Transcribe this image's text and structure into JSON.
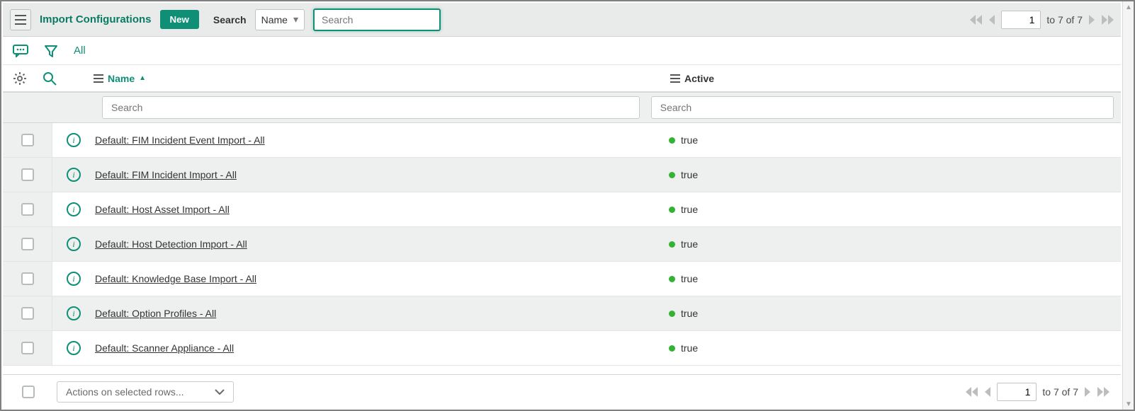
{
  "toolbar": {
    "title": "Import Configurations",
    "new_label": "New",
    "search_label": "Search",
    "search_field_selected": "Name",
    "search_placeholder": "Search"
  },
  "pager_top": {
    "page": "1",
    "range": "to 7 of 7"
  },
  "filterbar": {
    "all_label": "All"
  },
  "columns": {
    "name": "Name",
    "active": "Active"
  },
  "column_search": {
    "name_placeholder": "Search",
    "active_placeholder": "Search"
  },
  "rows": [
    {
      "name": "Default: FIM Incident Event Import - All",
      "active": "true"
    },
    {
      "name": "Default: FIM Incident Import - All",
      "active": "true"
    },
    {
      "name": "Default: Host Asset Import - All",
      "active": "true"
    },
    {
      "name": "Default: Host Detection Import - All",
      "active": "true"
    },
    {
      "name": "Default: Knowledge Base Import - All",
      "active": "true"
    },
    {
      "name": "Default: Option Profiles - All",
      "active": "true"
    },
    {
      "name": "Default: Scanner Appliance - All",
      "active": "true"
    }
  ],
  "footer": {
    "actions_placeholder": "Actions on selected rows..."
  },
  "pager_bottom": {
    "page": "1",
    "range": "to 7 of 7"
  }
}
